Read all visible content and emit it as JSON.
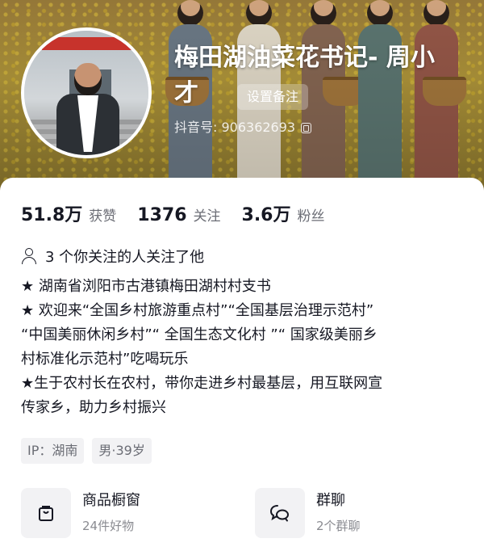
{
  "profile": {
    "title": "梅田湖油菜花书记- 周小才",
    "remark_button": "设置备注",
    "douyin_id": "抖音号: 906362693"
  },
  "stats": [
    {
      "value": "51.8万",
      "label": "获赞"
    },
    {
      "value": "1376",
      "label": "关注"
    },
    {
      "value": "3.6万",
      "label": "粉丝"
    }
  ],
  "mutual_follow": "3 个你关注的人关注了他",
  "bio_lines": [
    "★ 湖南省浏阳市古港镇梅田湖村村支书",
    "★ 欢迎来“全国乡村旅游重点村”“全国基层治理示范村”",
    "“中国美丽休闲乡村”“ 全国生态文化村 ”“ 国家级美丽乡",
    "村标准化示范村”吃喝玩乐",
    "★生于农村长在农村，带你走进乡村最基层，用互联网宣",
    "传家乡，助力乡村振兴"
  ],
  "tags": [
    "IP：湖南",
    "男·39岁"
  ],
  "tiles": [
    {
      "icon": "shopping-bag-icon",
      "title": "商品橱窗",
      "subtitle": "24件好物"
    },
    {
      "icon": "group-chat-icon",
      "title": "群聊",
      "subtitle": "2个群聊"
    }
  ],
  "colors": {
    "accent_text": "#161823",
    "muted_text": "#6b6d75",
    "tile_bg": "#f2f2f4"
  }
}
